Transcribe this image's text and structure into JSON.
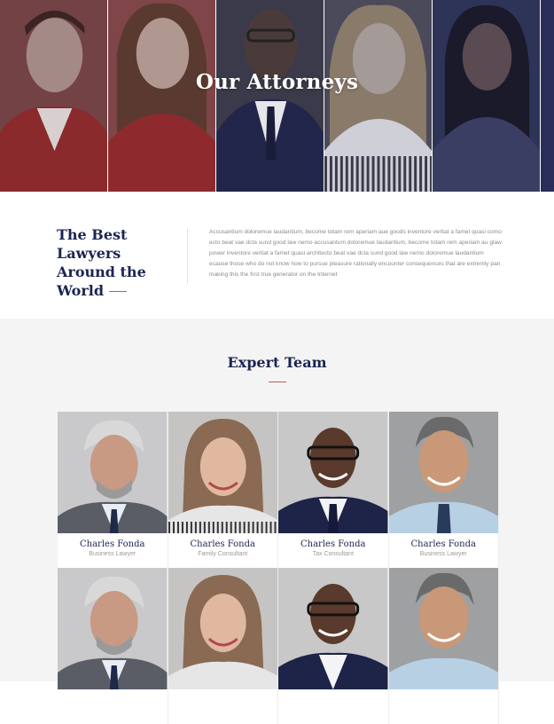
{
  "hero": {
    "title": "Our Attorneys"
  },
  "intro": {
    "heading": "The Best Lawyers Around the World",
    "paragraph": "Accusantium doloremue laudantium, become totam rem aperiam aue goods inventore veritat a famet quasi como ecto beat vae dcta sund good law nemo accusantum doloremue laudantium, become totam rem aperiam au glaw power inventore veritat a famet quasi architecto beat vae dcta sund good law nemo doloremue laudantium ecause those who do not know how to pursue pleasure rationally encounter consequences that are extremly pan making this the first true generator on the Internet"
  },
  "team": {
    "title": "Expert Team",
    "members": [
      {
        "name": "Charles Fonda",
        "role": "Business Lawyer"
      },
      {
        "name": "Charles Fonda",
        "role": "Family Consultant"
      },
      {
        "name": "Charles Fonda",
        "role": "Tax Consultant"
      },
      {
        "name": "Charles Fonda",
        "role": "Business Lawyer"
      },
      {
        "name": "",
        "role": ""
      },
      {
        "name": "",
        "role": ""
      },
      {
        "name": "",
        "role": ""
      },
      {
        "name": "",
        "role": ""
      }
    ]
  },
  "colors": {
    "navy": "#1c2452",
    "accent": "#c45a5a",
    "hero_red": "#7a2a2c",
    "hero_blue": "#2a2f5a",
    "section_bg": "#f4f4f4"
  }
}
